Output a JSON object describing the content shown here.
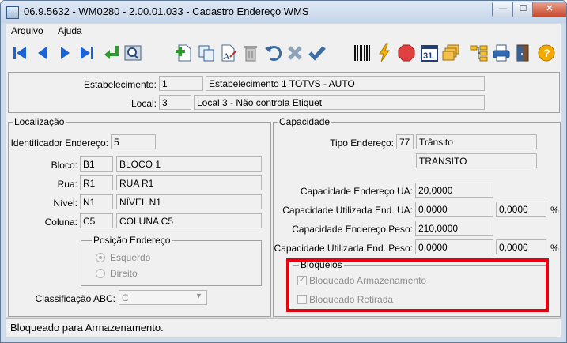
{
  "window": {
    "title": "06.9.5632 - WM0280 - 2.00.01.033 - Cadastro Endereço WMS",
    "min_glyph": "—",
    "max_glyph": "☐",
    "close_glyph": "✕"
  },
  "menu": {
    "items": [
      {
        "label": "Arquivo"
      },
      {
        "label": "Ajuda"
      }
    ]
  },
  "toolbar": {
    "buttons": [
      {
        "icon": "first-record-icon"
      },
      {
        "icon": "previous-record-icon"
      },
      {
        "icon": "next-record-icon"
      },
      {
        "icon": "last-record-icon"
      },
      {
        "icon": "goto-icon"
      },
      {
        "icon": "search-icon"
      },
      {
        "icon": "new-record-icon"
      },
      {
        "icon": "copy-icon"
      },
      {
        "icon": "edit-icon"
      },
      {
        "icon": "delete-icon"
      },
      {
        "icon": "undo-icon"
      },
      {
        "icon": "cancel-icon"
      },
      {
        "icon": "save-icon"
      },
      {
        "icon": "barcode-icon"
      },
      {
        "icon": "lightning-icon"
      },
      {
        "icon": "stop-icon"
      },
      {
        "icon": "calendar-icon",
        "text": "31"
      },
      {
        "icon": "stack-icon"
      },
      {
        "icon": "tree-icon"
      },
      {
        "icon": "print-icon"
      },
      {
        "icon": "exit-icon"
      },
      {
        "icon": "help-icon",
        "text": "?"
      }
    ]
  },
  "header": {
    "estabelecimento": {
      "label": "Estabelecimento:",
      "code": "1",
      "desc": "Estabelecimento 1 TOTVS - AUTO"
    },
    "local": {
      "label": "Local:",
      "code": "3",
      "desc": "Local 3 - Não controla Etiquet"
    }
  },
  "localizacao": {
    "title": "Localização",
    "identificador": {
      "label": "Identificador Endereço:",
      "value": "5"
    },
    "bloco": {
      "label": "Bloco:",
      "code": "B1",
      "desc": "BLOCO 1"
    },
    "rua": {
      "label": "Rua:",
      "code": "R1",
      "desc": "RUA R1"
    },
    "nivel": {
      "label": "Nível:",
      "code": "N1",
      "desc": "NÍVEL N1"
    },
    "coluna": {
      "label": "Coluna:",
      "code": "C5",
      "desc": "COLUNA C5"
    },
    "posicao": {
      "title": "Posição Endereço",
      "options": [
        {
          "label": "Esquerdo",
          "selected": true
        },
        {
          "label": "Direito",
          "selected": false
        }
      ]
    },
    "classificacao": {
      "label": "Classificação ABC:",
      "value": "C"
    }
  },
  "capacidade": {
    "title": "Capacidade",
    "tipo": {
      "label": "Tipo Endereço:",
      "code": "77",
      "desc": "Trânsito",
      "desc2": "TRANSITO"
    },
    "cap_ua": {
      "label": "Capacidade Endereço UA:",
      "value": "20,0000"
    },
    "cap_util_ua": {
      "label": "Capacidade Utilizada End. UA:",
      "value": "0,0000",
      "pct": "0,0000",
      "unit": "%"
    },
    "cap_peso": {
      "label": "Capacidade Endereço Peso:",
      "value": "210,0000"
    },
    "cap_util_peso": {
      "label": "Capacidade Utilizada End. Peso:",
      "value": "0,0000",
      "pct": "0,0000",
      "unit": "%"
    },
    "bloqueios": {
      "title": "Bloqueios",
      "armazenamento": {
        "label": "Bloqueado Armazenamento",
        "checked": true
      },
      "retirada": {
        "label": "Bloqueado Retirada",
        "checked": false
      }
    }
  },
  "status": {
    "text": "Bloqueado para Armazenamento."
  },
  "colors": {
    "highlight": "#e8000f",
    "nav_blue": "#1a64d6"
  }
}
